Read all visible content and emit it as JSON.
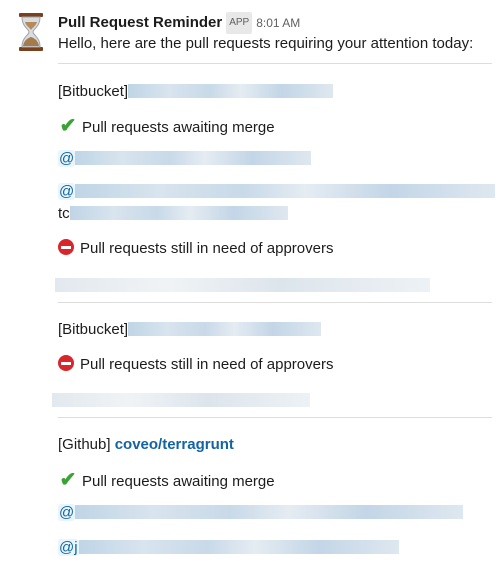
{
  "message": {
    "sender": "Pull Request Reminder",
    "badge": "APP",
    "time": "8:01 AM",
    "avatar_icon": "hourglass-icon",
    "intro": "Hello, here are the pull requests requiring your attention today:"
  },
  "sections": [
    {
      "source": "[Bitbucket]",
      "groups": [
        {
          "icon": "check-icon",
          "title": "Pull requests awaiting merge",
          "items": [
            "@",
            "@"
          ],
          "wrap_fragment": "tc"
        },
        {
          "icon": "no-entry-icon",
          "title": "Pull requests still in need of approvers"
        }
      ]
    },
    {
      "source": "[Bitbucket]",
      "groups": [
        {
          "icon": "no-entry-icon",
          "title": "Pull requests still in need of approvers"
        }
      ]
    },
    {
      "source": "[Github]",
      "repo": "coveo/terragrunt",
      "groups": [
        {
          "icon": "check-icon",
          "title": "Pull requests awaiting merge",
          "items": [
            "@",
            "@j"
          ]
        }
      ]
    }
  ],
  "colors": {
    "link": "#1264a3",
    "check": "#3aa335",
    "no_entry": "#d8262c"
  }
}
